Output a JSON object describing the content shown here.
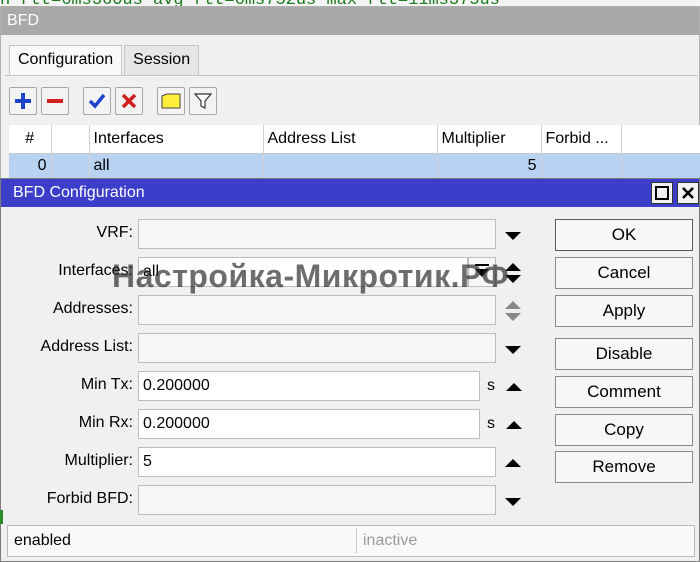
{
  "terminal": {
    "text": "n rtt=6ms360us avg-rtt=6ms752us max-rtt=11ms375us"
  },
  "window": {
    "title": "BFD"
  },
  "tabs": [
    {
      "label": "Configuration"
    },
    {
      "label": "Session"
    }
  ],
  "table": {
    "headers": [
      "#",
      "",
      "Interfaces",
      "Address List",
      "Multiplier",
      "Forbid ..."
    ],
    "rows": [
      {
        "num": "0",
        "flag": "",
        "interfaces": "all",
        "address_list": "",
        "multiplier": "5",
        "forbid": ""
      }
    ]
  },
  "dialog": {
    "title": "BFD Configuration",
    "fields": {
      "vrf": {
        "label": "VRF:",
        "value": ""
      },
      "interfaces": {
        "label": "Interfaces:",
        "value": "all"
      },
      "addresses": {
        "label": "Addresses:",
        "value": ""
      },
      "address_list": {
        "label": "Address List:",
        "value": ""
      },
      "min_tx": {
        "label": "Min Tx:",
        "value": "0.200000",
        "unit": "s"
      },
      "min_rx": {
        "label": "Min Rx:",
        "value": "0.200000",
        "unit": "s"
      },
      "multiplier": {
        "label": "Multiplier:",
        "value": "5"
      },
      "forbid_bfd": {
        "label": "Forbid BFD:",
        "value": ""
      }
    },
    "buttons": {
      "ok": "OK",
      "cancel": "Cancel",
      "apply": "Apply",
      "disable": "Disable",
      "comment": "Comment",
      "copy": "Copy",
      "remove": "Remove"
    },
    "status": {
      "left": "enabled",
      "right": "inactive"
    }
  },
  "watermark": "Настройка-Микротик.РФ",
  "colors": {
    "dialog_title": "#3c3ec9",
    "selected_row": "#b8d3f2",
    "window_title": "#a9a9a9"
  }
}
